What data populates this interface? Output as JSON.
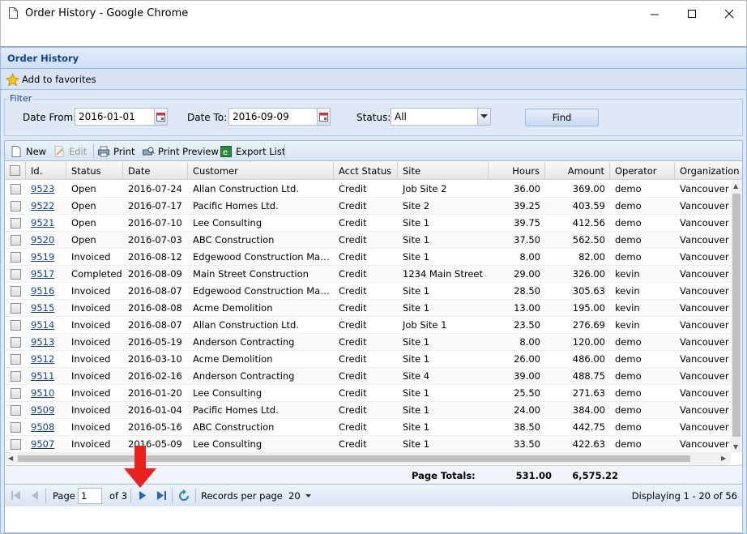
{
  "window": {
    "title": "Order History - Google Chrome"
  },
  "panel": {
    "title": "Order History",
    "favorites_label": "Add to favorites"
  },
  "filter": {
    "legend": "Filter",
    "date_from_label": "Date From:",
    "date_from_value": "2016-01-01",
    "date_to_label": "Date To:",
    "date_to_value": "2016-09-09",
    "status_label": "Status:",
    "status_value": "All",
    "find_label": "Find"
  },
  "toolbar": {
    "new": "New",
    "edit": "Edit",
    "print": "Print",
    "print_preview": "Print Preview",
    "export": "Export List"
  },
  "columns": [
    "Id.",
    "Status",
    "Date",
    "Customer",
    "Acct Status",
    "Site",
    "Hours",
    "Amount",
    "Operator",
    "Organization Un"
  ],
  "rows": [
    [
      "9523",
      "Open",
      "2016-07-24",
      "Allan Construction Ltd.",
      "Credit",
      "Job Site 2",
      "36.00",
      "369.00",
      "demo",
      "Vancouver"
    ],
    [
      "9522",
      "Open",
      "2016-07-17",
      "Pacific Homes Ltd.",
      "Credit",
      "Site 2",
      "39.25",
      "403.59",
      "demo",
      "Vancouver"
    ],
    [
      "9521",
      "Open",
      "2016-07-10",
      "Lee Consulting",
      "Credit",
      "Site 1",
      "39.75",
      "412.56",
      "demo",
      "Vancouver"
    ],
    [
      "9520",
      "Open",
      "2016-07-03",
      "ABC Construction",
      "Credit",
      "Site 1",
      "37.50",
      "562.50",
      "demo",
      "Vancouver"
    ],
    [
      "9519",
      "Invoiced",
      "2016-08-12",
      "Edgewood Construction Manage...",
      "Credit",
      "Site 1",
      "8.00",
      "82.00",
      "demo",
      "Vancouver"
    ],
    [
      "9517",
      "Completed",
      "2016-08-09",
      "Main Street Construction",
      "Credit",
      "1234 Main Street",
      "29.00",
      "326.00",
      "kevin",
      "Vancouver"
    ],
    [
      "9516",
      "Invoiced",
      "2016-08-07",
      "Edgewood Construction Manage...",
      "Credit",
      "Site 1",
      "28.50",
      "305.63",
      "kevin",
      "Vancouver"
    ],
    [
      "9515",
      "Invoiced",
      "2016-08-08",
      "Acme Demolition",
      "Credit",
      "Site 1",
      "13.00",
      "195.00",
      "kevin",
      "Vancouver"
    ],
    [
      "9514",
      "Invoiced",
      "2016-08-07",
      "Allan Construction Ltd.",
      "Credit",
      "Job Site 1",
      "23.50",
      "276.69",
      "kevin",
      "Vancouver"
    ],
    [
      "9513",
      "Invoiced",
      "2016-05-19",
      "Anderson Contracting",
      "Credit",
      "Site 1",
      "8.00",
      "120.00",
      "demo",
      "Vancouver"
    ],
    [
      "9512",
      "Invoiced",
      "2016-03-10",
      "Acme Demolition",
      "Credit",
      "Site 1",
      "26.00",
      "486.00",
      "demo",
      "Vancouver"
    ],
    [
      "9511",
      "Invoiced",
      "2016-02-16",
      "Anderson Contracting",
      "Credit",
      "Site 4",
      "39.00",
      "488.75",
      "demo",
      "Vancouver"
    ],
    [
      "9510",
      "Invoiced",
      "2016-01-20",
      "Lee Consulting",
      "Credit",
      "Site 1",
      "25.50",
      "271.63",
      "demo",
      "Vancouver"
    ],
    [
      "9509",
      "Invoiced",
      "2016-01-04",
      "Pacific Homes Ltd.",
      "Credit",
      "Site 1",
      "24.00",
      "384.00",
      "demo",
      "Vancouver"
    ],
    [
      "9508",
      "Invoiced",
      "2016-05-16",
      "ABC Construction",
      "Credit",
      "Site 1",
      "38.50",
      "442.75",
      "demo",
      "Vancouver"
    ],
    [
      "9507",
      "Invoiced",
      "2016-05-09",
      "Lee Consulting",
      "Credit",
      "Site 1",
      "33.50",
      "422.63",
      "demo",
      "Vancouver"
    ]
  ],
  "totals": {
    "label": "Page Totals:",
    "hours": "531.00",
    "amount": "6,575.22"
  },
  "paging": {
    "page_label": "Page",
    "page_value": "1",
    "of_label": "of 3",
    "records_label": "Records per page",
    "records_value": "20",
    "displaying": "Displaying 1 - 20 of 56"
  },
  "colors": {
    "panel_title": "#15428b",
    "link": "#15428b",
    "annotation_arrow": "#e8231f"
  }
}
